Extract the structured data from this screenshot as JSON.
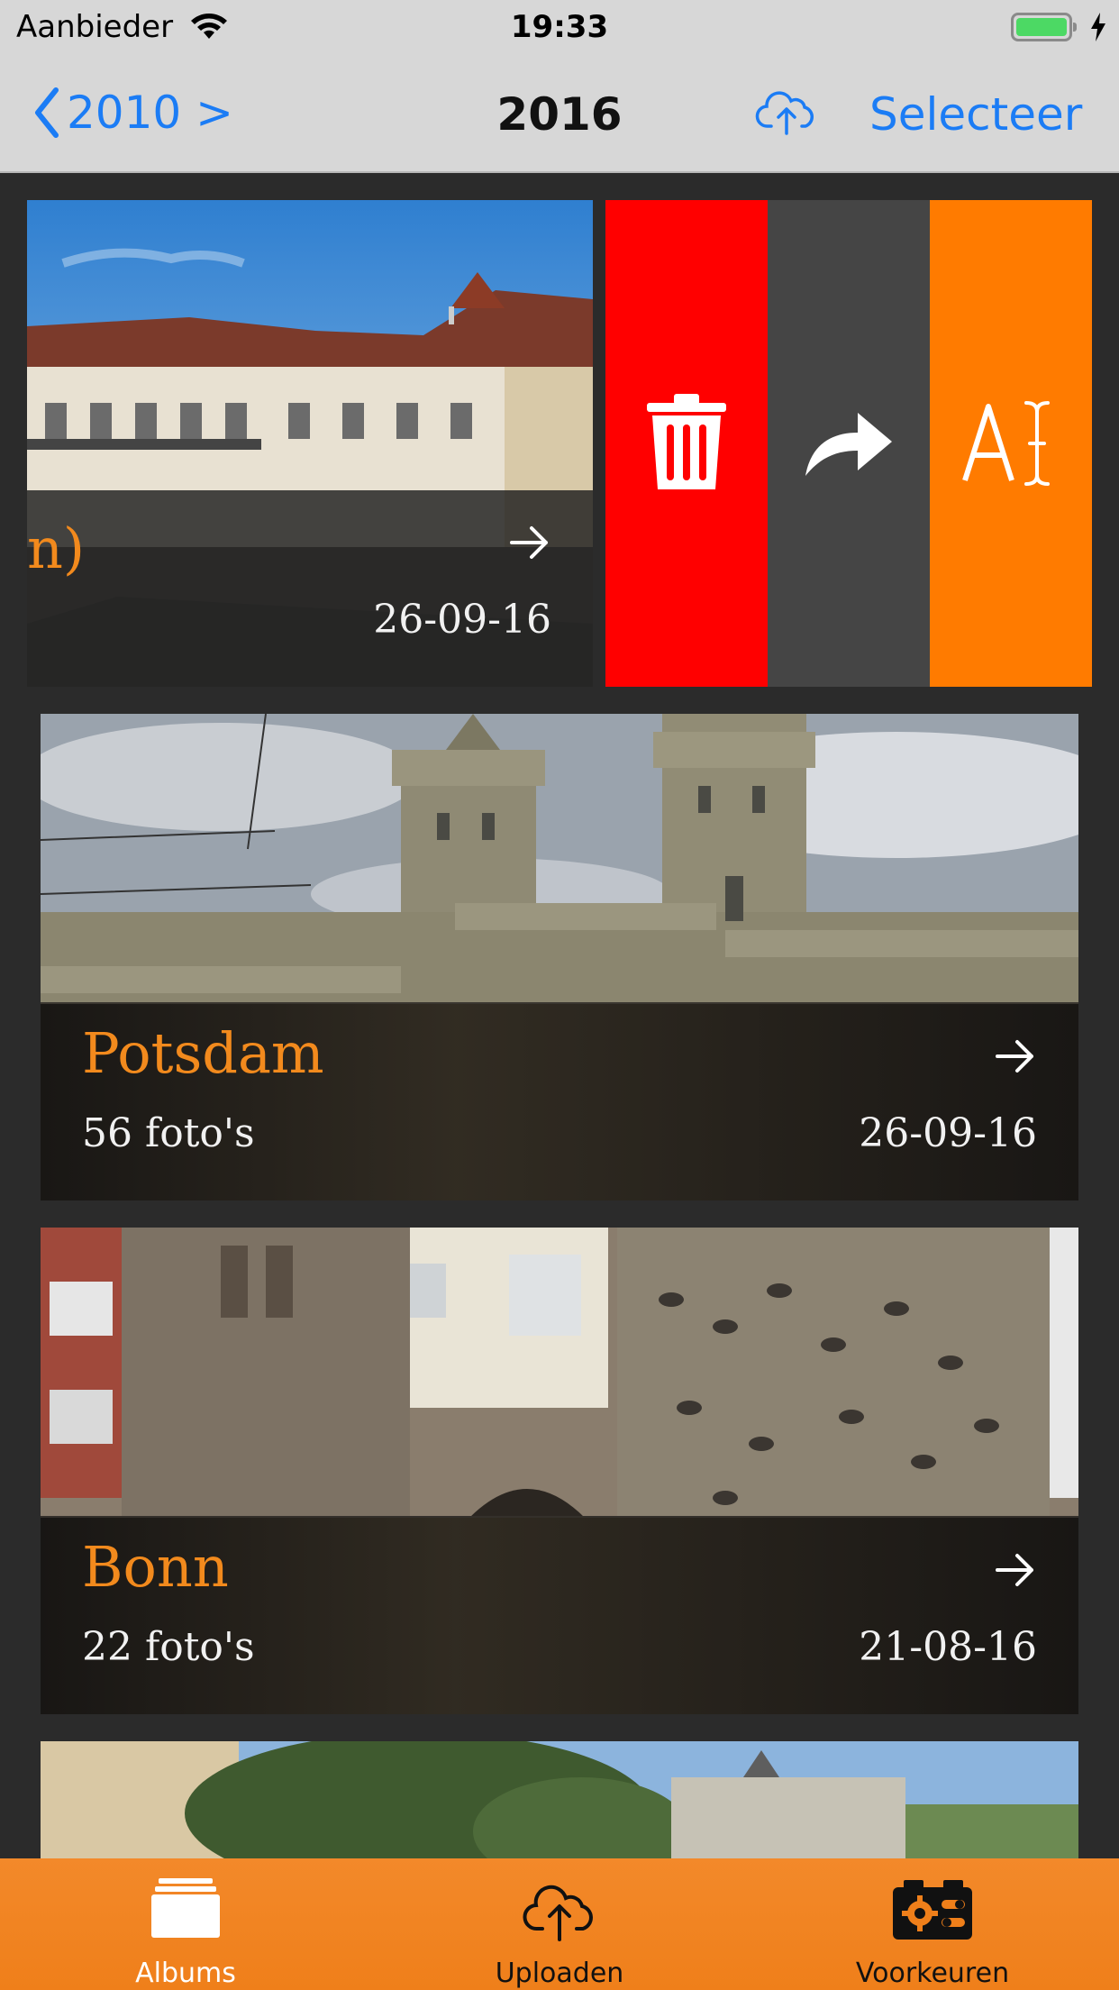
{
  "status_bar": {
    "carrier": "Aanbieder",
    "time": "19:33"
  },
  "nav": {
    "back_label": "2010 >",
    "title": "2016",
    "select_label": "Selecteer"
  },
  "swiped_album": {
    "title_fragment": "n)",
    "date": "26-09-16"
  },
  "albums": [
    {
      "title": "Potsdam",
      "count": "56 foto's",
      "date": "26-09-16"
    },
    {
      "title": "Bonn",
      "count": "22 foto's",
      "date": "21-08-16"
    }
  ],
  "tabs": [
    {
      "label": "Albums",
      "icon": "albums-icon",
      "active": true
    },
    {
      "label": "Uploaden",
      "icon": "cloud-upload-icon",
      "active": false
    },
    {
      "label": "Voorkeuren",
      "icon": "settings-camera-icon",
      "active": false
    }
  ],
  "actions": [
    "delete-icon",
    "share-icon",
    "rename-icon"
  ],
  "colors": {
    "accent": "#f28a1d",
    "ios_blue": "#1b7cf5",
    "delete": "#ff0000",
    "rename": "#ff7b00"
  }
}
